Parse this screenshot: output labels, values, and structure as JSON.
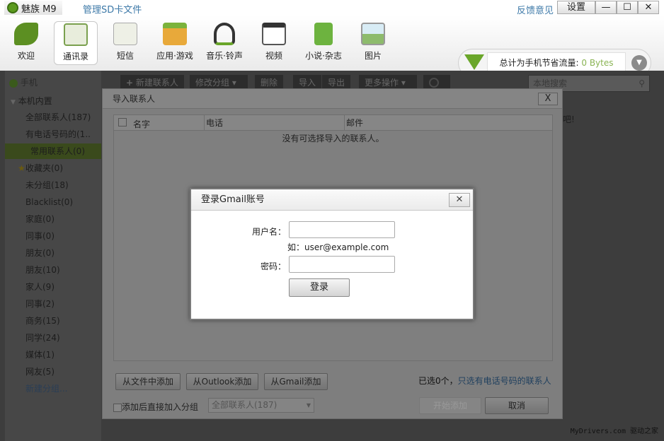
{
  "titlebar": {
    "app_name": "魅族 M9",
    "sd_link": "管理SD卡文件",
    "feedback": "反馈意见",
    "settings": "设置",
    "minimize": "—",
    "maximize": "☐",
    "close": "✕"
  },
  "toolbar": {
    "items": [
      {
        "label": "欢迎",
        "color": "#5c8f22"
      },
      {
        "label": "通讯录",
        "color": "#7aa04e"
      },
      {
        "label": "短信",
        "color": "#d9dccf"
      },
      {
        "label": "应用·游戏",
        "color": "#e8a93a"
      },
      {
        "label": "音乐·铃声",
        "color": "#3a3a3a"
      },
      {
        "label": "视频",
        "color": "#555555"
      },
      {
        "label": "小说·杂志",
        "color": "#6db33f"
      },
      {
        "label": "图片",
        "color": "#8dbb6c"
      }
    ]
  },
  "traffic": {
    "label": "总计为手机节省流量:",
    "value": "0 Bytes"
  },
  "sidebar": {
    "phone": "手机",
    "group": "本机内置",
    "items": [
      "全部联系人(187)",
      "有电话号码的(1..",
      "常用联系人(0)",
      "收藏夹(0)",
      "未分组(18)",
      "Blacklist(0)",
      "家庭(0)",
      "同事(0)",
      "朋友(0)",
      "朋友(10)",
      "家人(9)",
      "同事(2)",
      "商务(15)",
      "同学(24)",
      "媒体(1)",
      "网友(5)"
    ],
    "new_group": "新建分组..."
  },
  "content_toolbar": {
    "new_contact": "新建联系人",
    "change_group": "修改分组 ▾",
    "delete": "删除",
    "import": "导入",
    "export": "导出",
    "more": "更多操作 ▾",
    "search_placeholder": "本地搜索",
    "partial_text": "吧!"
  },
  "import_dialog": {
    "title": "导入联系人",
    "close": "X",
    "columns": [
      "名字",
      "电话",
      "邮件"
    ],
    "empty": "没有可选择导入的联系人。",
    "from_file": "从文件中添加",
    "from_outlook": "从Outlook添加",
    "from_gmail": "从Gmail添加",
    "selected": "已选0个，",
    "only_phone": "只选有电话号码的联系人",
    "add_to_group": "添加后直接加入分组",
    "group_select": "全部联系人(187)",
    "start": "开始添加",
    "cancel": "取消"
  },
  "gmail_dialog": {
    "title": "登录Gmail账号",
    "close": "✕",
    "username_label": "用户名：",
    "username_value": "",
    "hint": "如：user@example.com",
    "password_label": "密码：",
    "password_value": "",
    "login": "登录"
  },
  "watermark": "MyDrivers.com 驱动之家"
}
